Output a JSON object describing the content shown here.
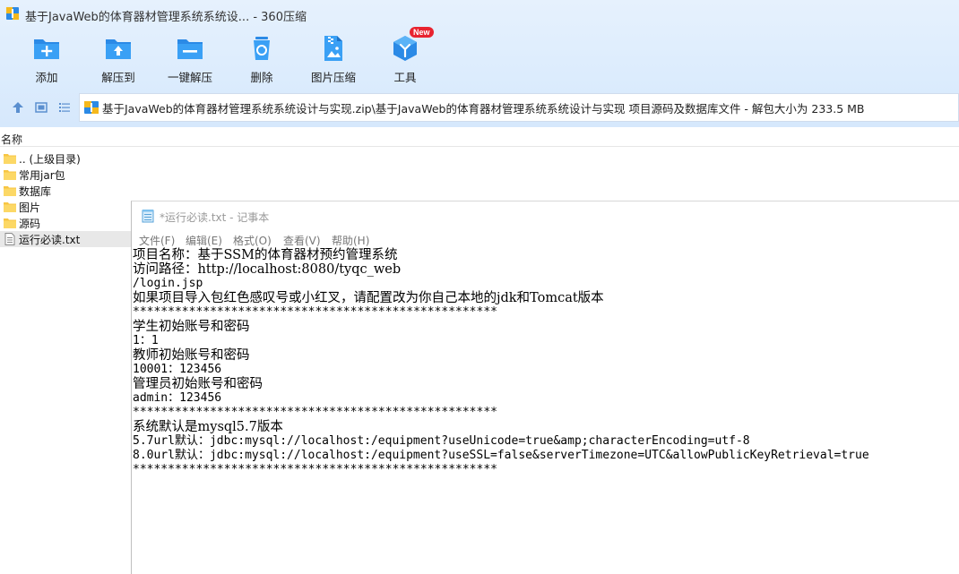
{
  "window": {
    "title": "基于JavaWeb的体育器材管理系统系统设... - 360压缩"
  },
  "toolbar": {
    "add": "添加",
    "extract_to": "解压到",
    "one_click_extract": "一键解压",
    "delete": "删除",
    "image_compress": "图片压缩",
    "tools": "工具",
    "tools_badge": "New"
  },
  "navbar": {
    "path": "基于JavaWeb的体育器材管理系统系统设计与实现.zip\\基于JavaWeb的体育器材管理系统系统设计与实现 项目源码及数据库文件 - 解包大小为 233.5 MB"
  },
  "filelist": {
    "column_name": "名称",
    "items": [
      {
        "name": ".. (上级目录)",
        "type": "folder"
      },
      {
        "name": "常用jar包",
        "type": "folder"
      },
      {
        "name": "数据库",
        "type": "folder"
      },
      {
        "name": "图片",
        "type": "folder"
      },
      {
        "name": "源码",
        "type": "folder"
      },
      {
        "name": "运行必读.txt",
        "type": "text-file",
        "selected": true
      }
    ]
  },
  "notepad": {
    "title": "*运行必读.txt - 记事本",
    "menu": {
      "file": "文件(F)",
      "edit": "编辑(E)",
      "format": "格式(O)",
      "view": "查看(V)",
      "help": "帮助(H)"
    },
    "lines": [
      "项目名称：基于SSM的体育器材预约管理系统",
      "访问路径：http://localhost:8080/tyqc_web",
      "/login.jsp",
      "如果项目导入包红色感叹号或小红叉，请配置改为你自己本地的jdk和Tomcat版本",
      "****************************************************",
      "学生初始账号和密码",
      "1：1",
      "教师初始账号和密码",
      "10001：123456",
      "管理员初始账号和密码",
      "admin：123456",
      "****************************************************",
      "系统默认是mysql5.7版本",
      "5.7url默认：jdbc:mysql://localhost:/equipment?useUnicode=true&amp;characterEncoding=utf-8",
      "8.0url默认：jdbc:mysql://localhost:/equipment?useSSL=false&serverTimezone=UTC&allowPublicKeyRetrieval=true",
      "****************************************************"
    ]
  },
  "colors": {
    "chrome_bg": "#dcecfd",
    "icon_blue": "#2b8ae6",
    "folder_yellow": "#f7c543",
    "badge_red": "#e8232f"
  }
}
